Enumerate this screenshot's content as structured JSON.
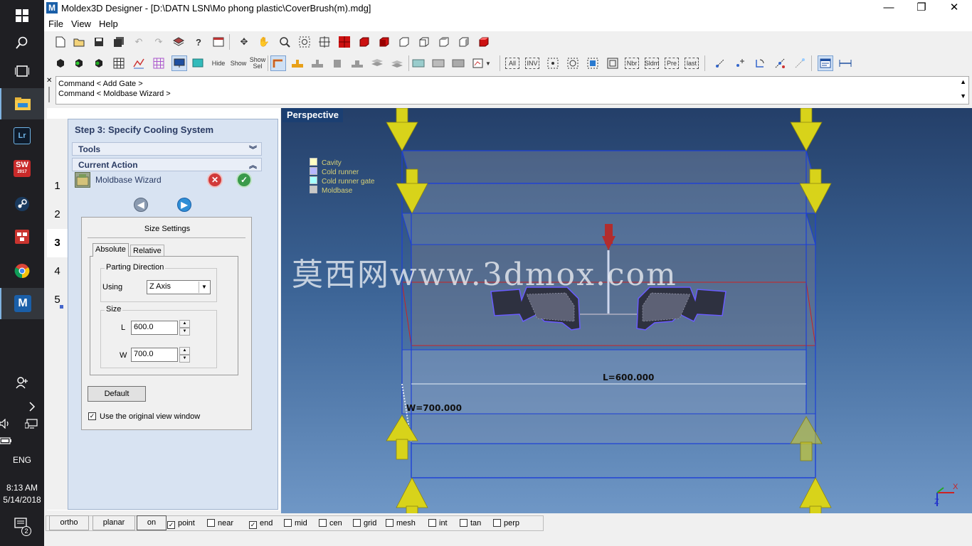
{
  "taskbar": {
    "apps": [
      "Lr",
      "SW",
      "M"
    ],
    "sw_year": "2017",
    "lang": "ENG",
    "time": "8:13 AM",
    "date": "5/14/2018",
    "notif_count": "2"
  },
  "window": {
    "app_icon": "M",
    "title": "Moldex3D Designer - [D:\\DATN LSN\\Mo phong plastic\\CoverBrush(m).mdg]",
    "minimize": "—",
    "restore": "❐",
    "close": "✕"
  },
  "menu": [
    "File",
    "View",
    "Help"
  ],
  "toolbar2_text": {
    "hide": "Hide",
    "show": "Show",
    "show_sel": "Show Sel",
    "all": "All",
    "inv": "INV",
    "nbr": "Nbr",
    "sldm": "Sldm",
    "pre": "Pre",
    "last": "last"
  },
  "command": {
    "lines": [
      "Command < Add Gate >",
      "Command < Moldbase Wizard >"
    ]
  },
  "wizard": {
    "step_title": "Step 3: Specify Cooling System",
    "steps": [
      "1",
      "2",
      "3",
      "4",
      "5"
    ],
    "tools_label": "Tools",
    "current_action_label": "Current Action",
    "action_name": "Moldbase Wizard",
    "size_settings_title": "Size Settings",
    "tab_absolute": "Absolute",
    "tab_relative": "Relative",
    "parting_direction_label": "Parting Direction",
    "using_label": "Using",
    "using_value": "Z Axis",
    "size_label": "Size",
    "l_label": "L",
    "l_value": "600.0",
    "w_label": "W",
    "w_value": "700.0",
    "default_button": "Default",
    "use_original_view": "Use the original view window",
    "use_original_view_checked": true
  },
  "viewport": {
    "mode_label": "Perspective",
    "legend": [
      {
        "label": "Cavity",
        "color": "#ffffc4"
      },
      {
        "label": "Cold runner",
        "color": "#b7b7ff"
      },
      {
        "label": "Cold runner gate",
        "color": "#a6ffff"
      },
      {
        "label": "Moldbase",
        "color": "#c8c8c8"
      }
    ],
    "dim_l": "L=600.000",
    "dim_w": "W=700.000",
    "watermark": "莫西网www.3dmox.com",
    "axis_x": "X",
    "axis_z": "Z"
  },
  "snapbar": {
    "ortho": "ortho",
    "planar": "planar",
    "on": "on",
    "items": [
      {
        "label": "point",
        "checked": true
      },
      {
        "label": "near",
        "checked": false
      },
      {
        "label": "end",
        "checked": true
      },
      {
        "label": "mid",
        "checked": false
      },
      {
        "label": "cen",
        "checked": false
      },
      {
        "label": "grid",
        "checked": false
      },
      {
        "label": "mesh",
        "checked": false
      },
      {
        "label": "int",
        "checked": false
      },
      {
        "label": "tan",
        "checked": false
      },
      {
        "label": "perp",
        "checked": false
      }
    ]
  },
  "colors": {
    "viewport_top": "#243f69",
    "viewport_bottom": "#6f97c6",
    "mold_outline": "#1d3fd6",
    "arrow": "#d8d31a",
    "gate": "#b22d2d"
  }
}
